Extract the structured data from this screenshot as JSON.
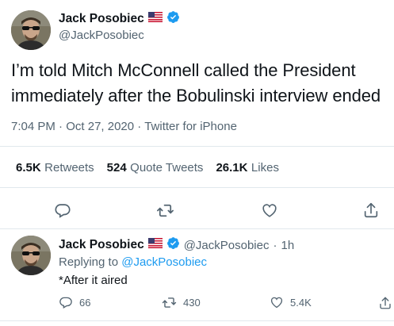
{
  "main_tweet": {
    "author_name": "Jack Posobiec",
    "author_handle": "@JackPosobiec",
    "text": "I’m told Mitch McConnell called the President immediately after the Bobulinski interview ended",
    "time": "7:04 PM",
    "date": "Oct 27, 2020",
    "source": "Twitter for iPhone",
    "sep": "·"
  },
  "stats": {
    "retweets_count": "6.5K",
    "retweets_label": "Retweets",
    "quotes_count": "524",
    "quotes_label": "Quote Tweets",
    "likes_count": "26.1K",
    "likes_label": "Likes"
  },
  "reply": {
    "author_name": "Jack Posobiec",
    "author_handle": "@JackPosobiec",
    "sep": "·",
    "time": "1h",
    "replying_to_prefix": "Replying to ",
    "replying_to_handle": "@JackPosobiec",
    "text": "*After it aired",
    "reply_count": "66",
    "retweet_count": "430",
    "like_count": "5.4K"
  },
  "colors": {
    "accent": "#1d9bf0",
    "secondary_text": "#536471",
    "divider": "#e1e8ed"
  },
  "icons": [
    "reply-icon",
    "retweet-icon",
    "like-icon",
    "share-icon",
    "verified-badge-icon",
    "us-flag-icon"
  ]
}
